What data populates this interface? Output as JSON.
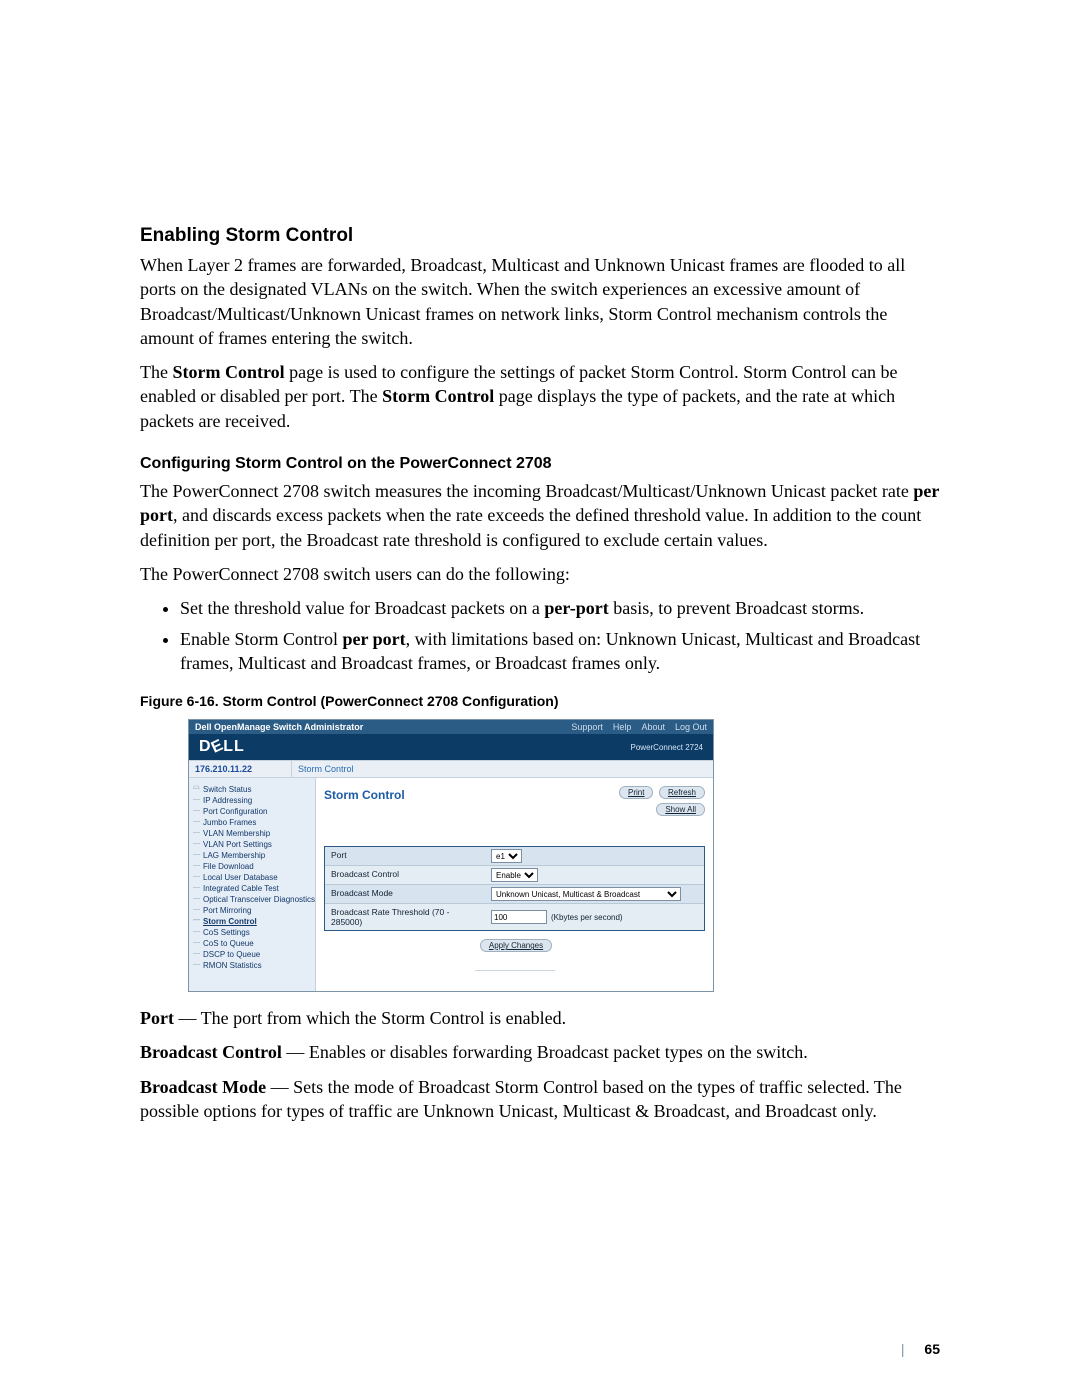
{
  "doc": {
    "section_title": "Enabling Storm Control",
    "para1": "When Layer 2 frames are forwarded, Broadcast, Multicast and Unknown Unicast frames are flooded to all ports on the designated VLANs on the switch. When the switch experiences an excessive amount of Broadcast/Multicast/Unknown Unicast frames on network links, Storm Control mechanism controls the amount of frames entering the switch.",
    "para2_pre": "The ",
    "para2_b1": "Storm Control",
    "para2_mid": " page is used to configure the settings of packet Storm Control. Storm Control can be enabled or disabled per port. The ",
    "para2_b2": "Storm Control",
    "para2_post": " page displays the type of packets, and the rate at which packets are received.",
    "sub_title": "Configuring Storm Control on the PowerConnect 2708",
    "para3_pre": "The PowerConnect 2708 switch measures the incoming Broadcast/Multicast/Unknown Unicast packet rate ",
    "para3_b1": "per port",
    "para3_post": ", and discards excess packets when the rate exceeds the defined threshold value. In addition to the count definition per port, the Broadcast rate threshold is configured to exclude certain values.",
    "para4": "The PowerConnect 2708 switch users can do the following:",
    "bullet1_pre": "Set the threshold value for Broadcast packets on a ",
    "bullet1_b": "per-port",
    "bullet1_post": " basis, to prevent Broadcast storms.",
    "bullet2_pre": "Enable Storm Control ",
    "bullet2_b": "per port",
    "bullet2_post": ", with limitations based on: Unknown Unicast, Multicast and Broadcast frames, Multicast and Broadcast frames, or Broadcast frames only.",
    "fig_caption": "Figure 6-16.    Storm Control (PowerConnect 2708 Configuration)",
    "def_port_b": "Port",
    "def_port_txt": " — The port from which the Storm Control is enabled.",
    "def_bc_b": "Broadcast Control",
    "def_bc_txt": " — Enables or disables forwarding Broadcast packet types on the switch.",
    "def_bm_b": "Broadcast Mode",
    "def_bm_txt": " — Sets the mode of Broadcast Storm Control based on the types of traffic selected. The possible options for types of traffic are Unknown Unicast, Multicast & Broadcast, and Broadcast only.",
    "page_no": "65"
  },
  "sc": {
    "topbar_title": "Dell OpenManage Switch Administrator",
    "top_links": {
      "support": "Support",
      "help": "Help",
      "about": "About",
      "logout": "Log Out"
    },
    "logo_text": "D",
    "logo_e": "E",
    "logo_text2": "LL",
    "product": "PowerConnect 2724",
    "ip": "176.210.11.22",
    "crumb": "Storm Control",
    "tree": [
      "Switch Status",
      "IP Addressing",
      "Port Configuration",
      "Jumbo Frames",
      "VLAN Membership",
      "VLAN Port Settings",
      "LAG Membership",
      "File Download",
      "Local User Database",
      "Integrated Cable Test",
      "Optical Transceiver Diagnostics",
      "Port Mirroring",
      "Storm Control",
      "CoS Settings",
      "CoS to Queue",
      "DSCP to Queue",
      "RMON Statistics"
    ],
    "tree_active_index": 12,
    "content_title": "Storm Control",
    "btn_print": "Print",
    "btn_refresh": "Refresh",
    "btn_showall": "Show All",
    "rows": {
      "port_label": "Port",
      "port_value": "e1",
      "bc_label": "Broadcast Control",
      "bc_value": "Enable",
      "bm_label": "Broadcast Mode",
      "bm_value": "Unknown Unicast, Multicast & Broadcast",
      "thr_label": "Broadcast Rate Threshold (70 - 285000)",
      "thr_value": "100",
      "thr_unit": "(Kbytes per second)"
    },
    "apply": "Apply Changes"
  }
}
